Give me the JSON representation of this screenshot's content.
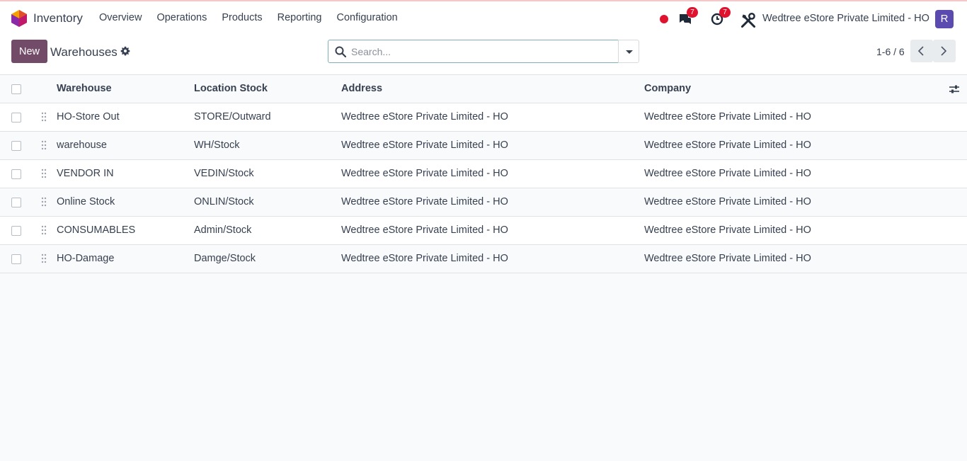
{
  "app": {
    "name": "Inventory"
  },
  "menu": [
    "Overview",
    "Operations",
    "Products",
    "Reporting",
    "Configuration"
  ],
  "systray": {
    "messages_count": "7",
    "activities_count": "7",
    "company": "Wedtree eStore Private Limited - HO",
    "avatar_initial": "R"
  },
  "control": {
    "new_label": "New",
    "title": "Warehouses",
    "search_placeholder": "Search...",
    "pager": "1-6 / 6"
  },
  "table": {
    "headers": {
      "warehouse": "Warehouse",
      "location_stock": "Location Stock",
      "address": "Address",
      "company": "Company"
    },
    "rows": [
      {
        "warehouse": "HO-Store Out",
        "location_stock": "STORE/Outward",
        "address": "Wedtree eStore Private Limited - HO",
        "company": "Wedtree eStore Private Limited - HO"
      },
      {
        "warehouse": "warehouse",
        "location_stock": "WH/Stock",
        "address": "Wedtree eStore Private Limited - HO",
        "company": "Wedtree eStore Private Limited - HO"
      },
      {
        "warehouse": "VENDOR IN",
        "location_stock": "VEDIN/Stock",
        "address": "Wedtree eStore Private Limited - HO",
        "company": "Wedtree eStore Private Limited - HO"
      },
      {
        "warehouse": "Online Stock",
        "location_stock": "ONLIN/Stock",
        "address": "Wedtree eStore Private Limited - HO",
        "company": "Wedtree eStore Private Limited - HO"
      },
      {
        "warehouse": "CONSUMABLES",
        "location_stock": "Admin/Stock",
        "address": "Wedtree eStore Private Limited - HO",
        "company": "Wedtree eStore Private Limited - HO"
      },
      {
        "warehouse": "HO-Damage",
        "location_stock": "Damge/Stock",
        "address": "Wedtree eStore Private Limited - HO",
        "company": "Wedtree eStore Private Limited - HO"
      }
    ]
  },
  "colors": {
    "primary": "#714b67",
    "badge": "#e0122e",
    "avatar": "#5b4ab0"
  },
  "icons": [
    "app-logo-icon",
    "chat-icon",
    "clock-icon",
    "tools-icon",
    "gear-icon",
    "search-icon",
    "caret-down-icon",
    "chevron-left-icon",
    "chevron-right-icon",
    "drag-handle-icon",
    "column-settings-icon"
  ]
}
